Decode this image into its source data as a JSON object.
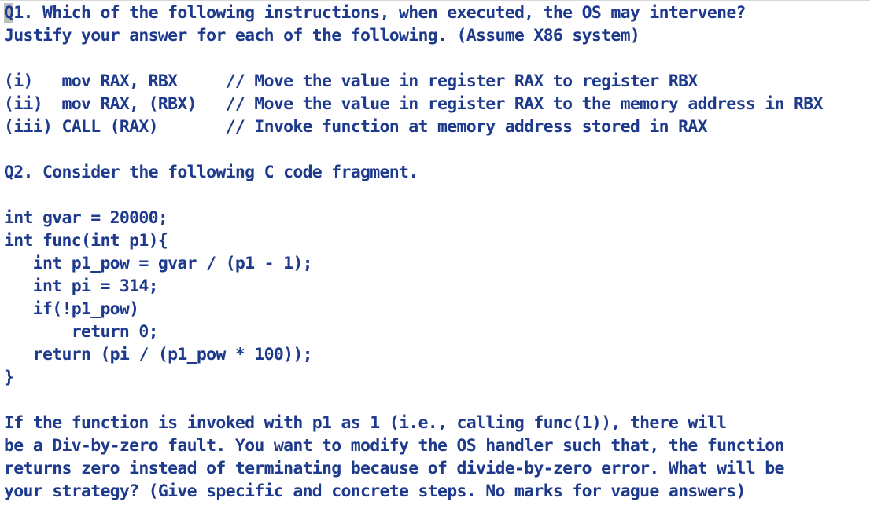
{
  "document": {
    "cursor_char": "Q",
    "lines": [
      "1. Which of the following instructions, when executed, the OS may intervene?",
      "Justify your answer for each of the following. (Assume X86 system)",
      "",
      "(i)   mov RAX, RBX     // Move the value in register RAX to register RBX",
      "(ii)  mov RAX, (RBX)   // Move the value in register RAX to the memory address in RBX",
      "(iii) CALL (RAX)       // Invoke function at memory address stored in RAX",
      "",
      "Q2. Consider the following C code fragment.",
      "",
      "int gvar = 20000;",
      "int func(int p1){",
      "   int p1_pow = gvar / (p1 - 1);",
      "   int pi = 314;",
      "   if(!p1_pow)",
      "       return 0;",
      "   return (pi / (p1_pow * 100));",
      "}",
      "",
      "If the function is invoked with p1 as 1 (i.e., calling func(1)), there will",
      "be a Div-by-zero fault. You want to modify the OS handler such that, the function",
      "returns zero instead of terminating because of divide-by-zero error. What will be",
      "your strategy? (Give specific and concrete steps. No marks for vague answers)"
    ]
  }
}
